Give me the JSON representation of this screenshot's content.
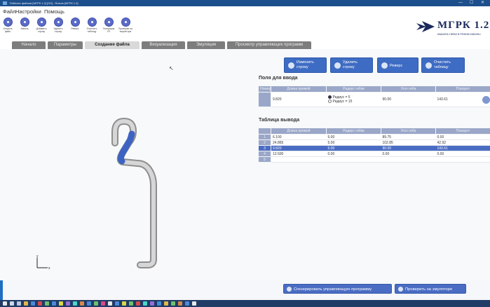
{
  "window": {
    "title": "Рабочее файлов [MГРК 1.2] [OS] - Rulons [MГРК 1.2]",
    "controls": [
      "—",
      "☐",
      "✕"
    ]
  },
  "menu": [
    "Файл",
    "Настройки",
    "Помощь"
  ],
  "toolbar": [
    {
      "label": "Открыть\nфайл",
      "icon": "folder-icon"
    },
    {
      "label": "Запись",
      "icon": "save-icon"
    },
    {
      "label": "Добавить\nстроку",
      "icon": "add-icon"
    },
    {
      "label": "Удалить\nстроку",
      "icon": "remove-icon"
    },
    {
      "label": "Реверс",
      "icon": "reverse-icon"
    },
    {
      "label": "Очистить\nтаблицу",
      "icon": "clear-icon"
    },
    {
      "label": "Генерация\nУП",
      "icon": "generate-icon"
    },
    {
      "label": "Проверка на\nэмуляторе",
      "icon": "check-icon"
    }
  ],
  "logo": {
    "name": "МГРК 1.2",
    "subtitle": "МАШИНА ГИБКИ В РЕЖИМ КАБИНЫ"
  },
  "tabs": [
    {
      "label": "Начало",
      "active": false
    },
    {
      "label": "Параметры",
      "active": false
    },
    {
      "label": "Создание файла",
      "active": true
    },
    {
      "label": "Визуализация",
      "active": false
    },
    {
      "label": "Эмуляция",
      "active": false
    },
    {
      "label": "Просмотр управляющих программ",
      "active": false
    }
  ],
  "actions": [
    {
      "label": "Изменить\nстроку"
    },
    {
      "label": "Удалить\nстроку"
    },
    {
      "label": "Реверс"
    },
    {
      "label": "Очистить\nтаблицу"
    }
  ],
  "input_section": {
    "title": "Поля для ввода",
    "columns": [
      "Номер",
      "Длина прямой",
      "Радиус гибки",
      "Угол гиба",
      "Поворот"
    ],
    "row": {
      "num": "",
      "length": "9.820",
      "radius_options": [
        {
          "label": "Радиус = 5",
          "checked": true
        },
        {
          "label": "Радиус = 15",
          "checked": false
        }
      ],
      "angle": "90.00",
      "rotation": "143.61"
    }
  },
  "output_section": {
    "title": "Таблица вывода",
    "columns": [
      "",
      "Длина прямой",
      "Радиус гибки",
      "Угол гиба",
      "Поворот"
    ],
    "rows": [
      {
        "n": "1",
        "cells": [
          "6.100",
          "5.00",
          "89.75",
          "0.00"
        ],
        "selected": false
      },
      {
        "n": "2",
        "cells": [
          "24.865",
          "5.00",
          "102.85",
          "42.92"
        ],
        "selected": false
      },
      {
        "n": "3",
        "cells": [
          "9.820",
          "5.00",
          "90.00",
          "143.61"
        ],
        "selected": true
      },
      {
        "n": "4",
        "cells": [
          "13.500",
          "0.00",
          "0.00",
          "0.00"
        ],
        "selected": false
      },
      {
        "n": "5",
        "cells": [
          "",
          "",
          "",
          ""
        ],
        "selected": false
      }
    ]
  },
  "bottom_buttons": [
    {
      "label": "Сгенерировать управляющую программу"
    },
    {
      "label": "Проверить на эмуляторе"
    }
  ],
  "axes": {
    "y": "y",
    "x": "x"
  },
  "colors": {
    "accent": "#3e6cc4",
    "header": "#9aa7c8",
    "selected_row": "#4a6cc3",
    "pipe_highlight": "#3d63c2"
  }
}
